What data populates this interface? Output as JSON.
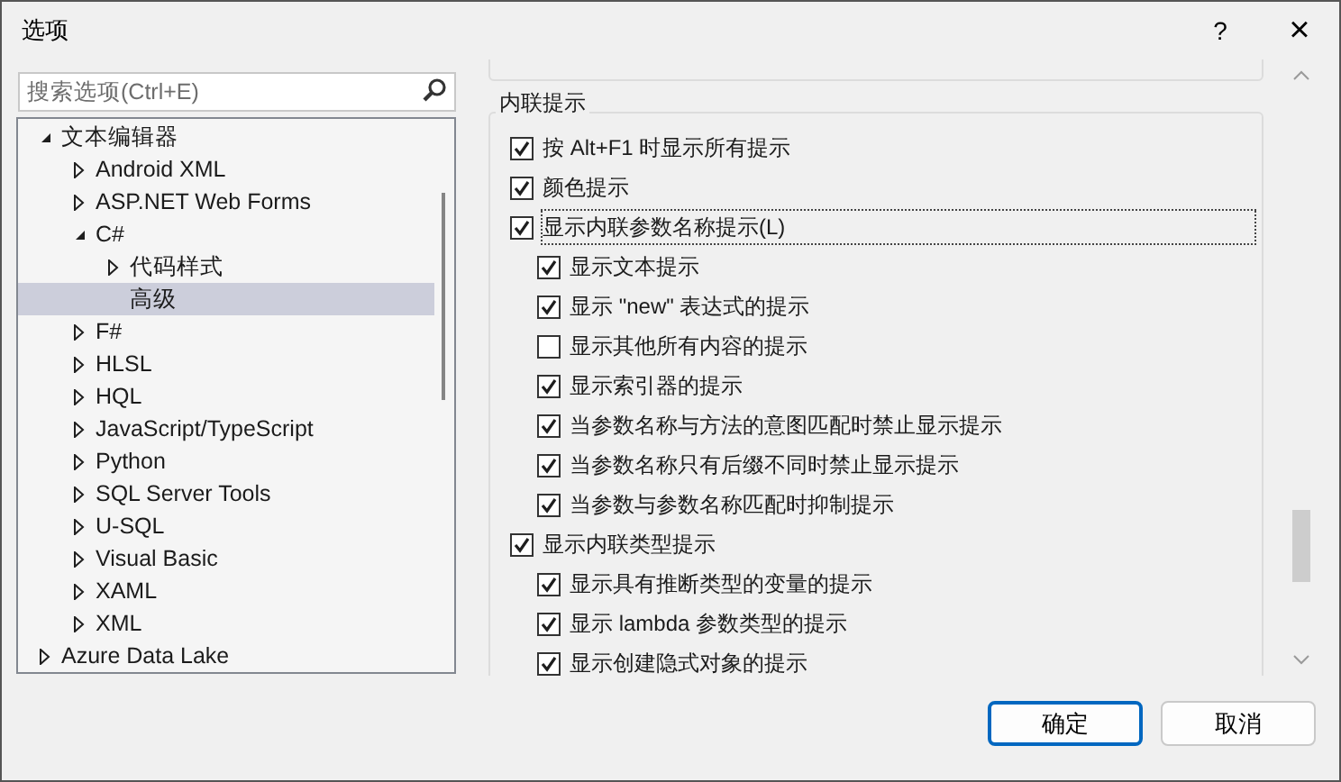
{
  "window": {
    "title": "选项",
    "help": "?",
    "close": "×"
  },
  "search": {
    "placeholder": "搜索选项(Ctrl+E)"
  },
  "tree": [
    {
      "label": "文本编辑器",
      "expanded": true,
      "selected": false,
      "children": [
        {
          "label": "Android XML",
          "expanded": false,
          "selected": false
        },
        {
          "label": "ASP.NET Web Forms",
          "expanded": false,
          "selected": false
        },
        {
          "label": "C#",
          "expanded": true,
          "selected": false,
          "children": [
            {
              "label": "代码样式",
              "expanded": false,
              "selected": false
            },
            {
              "label": "高级",
              "selected": true
            }
          ]
        },
        {
          "label": "F#",
          "expanded": false,
          "selected": false
        },
        {
          "label": "HLSL",
          "expanded": false,
          "selected": false
        },
        {
          "label": "HQL",
          "expanded": false,
          "selected": false
        },
        {
          "label": "JavaScript/TypeScript",
          "expanded": false,
          "selected": false
        },
        {
          "label": "Python",
          "expanded": false,
          "selected": false
        },
        {
          "label": "SQL Server Tools",
          "expanded": false,
          "selected": false
        },
        {
          "label": "U-SQL",
          "expanded": false,
          "selected": false
        },
        {
          "label": "Visual Basic",
          "expanded": false,
          "selected": false
        },
        {
          "label": "XAML",
          "expanded": false,
          "selected": false
        },
        {
          "label": "XML",
          "expanded": false,
          "selected": false
        }
      ]
    },
    {
      "label": "Azure Data Lake",
      "expanded": false,
      "selected": false
    }
  ],
  "group": {
    "title": "内联提示",
    "options": [
      {
        "label": "按 Alt+F1 时显示所有提示",
        "checked": true,
        "focused": false
      },
      {
        "label": "颜色提示",
        "checked": true,
        "focused": false
      },
      {
        "label": "显示内联参数名称提示(L)",
        "checked": true,
        "focused": true,
        "children": [
          {
            "label": "显示文本提示",
            "checked": true,
            "focused": false
          },
          {
            "label": "显示 \"new\" 表达式的提示",
            "checked": true,
            "focused": false
          },
          {
            "label": "显示其他所有内容的提示",
            "checked": false,
            "focused": false
          },
          {
            "label": "显示索引器的提示",
            "checked": true,
            "focused": false
          },
          {
            "label": "当参数名称与方法的意图匹配时禁止显示提示",
            "checked": true,
            "focused": false
          },
          {
            "label": "当参数名称只有后缀不同时禁止显示提示",
            "checked": true,
            "focused": false
          },
          {
            "label": "当参数与参数名称匹配时抑制提示",
            "checked": true,
            "focused": false
          }
        ]
      },
      {
        "label": "显示内联类型提示",
        "checked": true,
        "focused": false,
        "children": [
          {
            "label": "显示具有推断类型的变量的提示",
            "checked": true,
            "focused": false
          },
          {
            "label": "显示 lambda 参数类型的提示",
            "checked": true,
            "focused": false
          },
          {
            "label": "显示创建隐式对象的提示",
            "checked": true,
            "focused": false
          }
        ]
      }
    ]
  },
  "buttons": [
    {
      "label": "确定",
      "default": true
    },
    {
      "label": "取消",
      "default": false
    }
  ]
}
